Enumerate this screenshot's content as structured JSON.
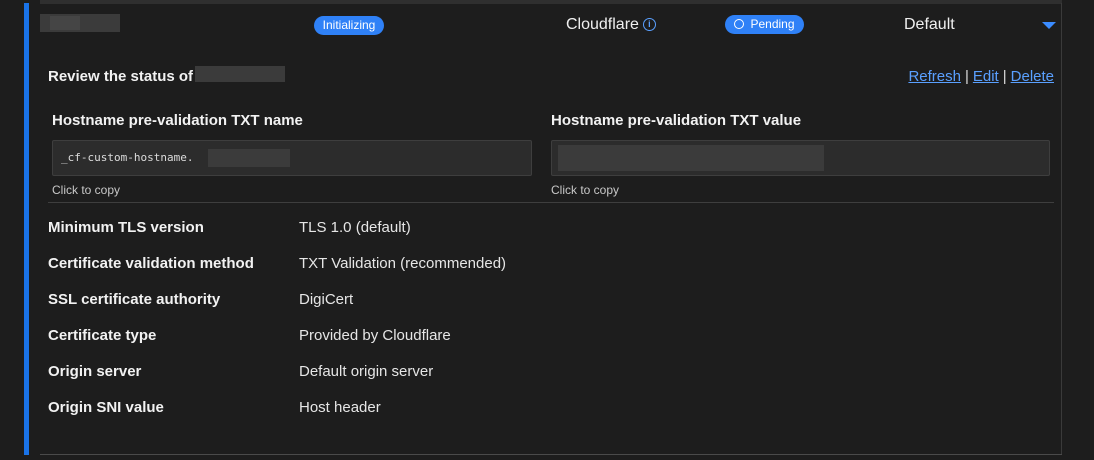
{
  "header": {
    "status_badge": "Initializing",
    "provider": "Cloudflare",
    "validation_badge": "Pending",
    "default_label": "Default"
  },
  "review": {
    "title": "Review the status of",
    "actions": {
      "refresh": "Refresh",
      "edit": "Edit",
      "delete": "Delete",
      "separator": "|"
    }
  },
  "txt_name": {
    "label": "Hostname pre-validation TXT name",
    "value_prefix": "_cf-custom-hostname.",
    "hint": "Click to copy"
  },
  "txt_value": {
    "label": "Hostname pre-validation TXT value",
    "hint": "Click to copy"
  },
  "properties": [
    {
      "label": "Minimum TLS version",
      "value": "TLS 1.0 (default)"
    },
    {
      "label": "Certificate validation method",
      "value": "TXT Validation (recommended)"
    },
    {
      "label": "SSL certificate authority",
      "value": "DigiCert"
    },
    {
      "label": "Certificate type",
      "value": "Provided by Cloudflare"
    },
    {
      "label": "Origin server",
      "value": "Default origin server"
    },
    {
      "label": "Origin SNI value",
      "value": "Host header"
    }
  ],
  "colors": {
    "accent": "#1a73e8",
    "badge": "#2f81f7",
    "link": "#5aa0ff",
    "background": "#1d1d1d"
  },
  "icons": {
    "info": "info-icon",
    "pending": "clock-icon",
    "expand": "chevron-down-icon"
  }
}
